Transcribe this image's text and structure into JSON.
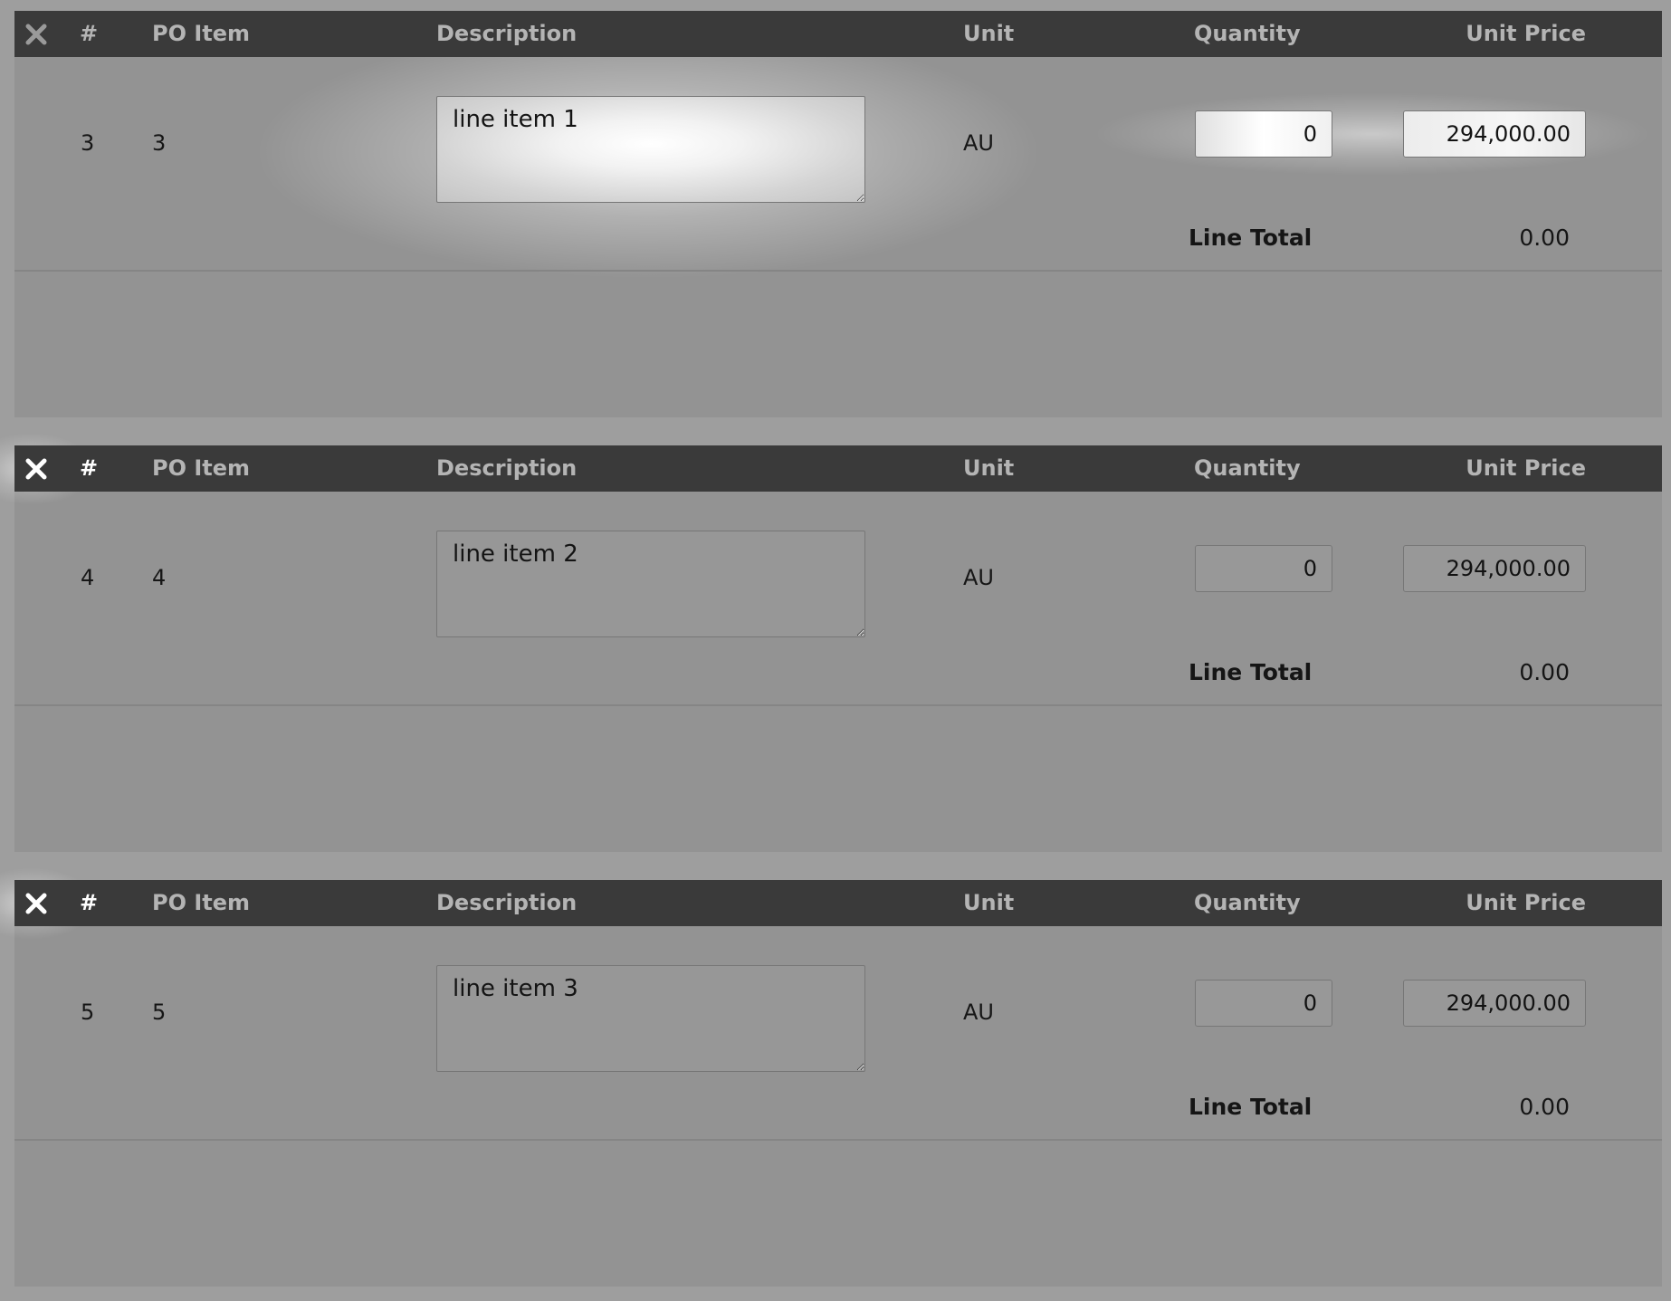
{
  "header": {
    "remove_icon": "close-x-icon",
    "num": "#",
    "po_item": "PO Item",
    "description": "Description",
    "unit": "Unit",
    "quantity": "Quantity",
    "unit_price": "Unit Price"
  },
  "line_total_label": "Line Total",
  "items": [
    {
      "num": "3",
      "po_item": "3",
      "description": "line item 1",
      "unit": "AU",
      "quantity": "0",
      "unit_price": "294,000.00",
      "line_total": "0.00"
    },
    {
      "num": "4",
      "po_item": "4",
      "description": "line item 2",
      "unit": "AU",
      "quantity": "0",
      "unit_price": "294,000.00",
      "line_total": "0.00"
    },
    {
      "num": "5",
      "po_item": "5",
      "description": "line item 3",
      "unit": "AU",
      "quantity": "0",
      "unit_price": "294,000.00",
      "line_total": "0.00"
    }
  ],
  "colors": {
    "page_bg": "#9e9e9e",
    "block_bg": "#939393",
    "header_bg": "#3a3a3a",
    "header_text": "#b4b4b4"
  }
}
